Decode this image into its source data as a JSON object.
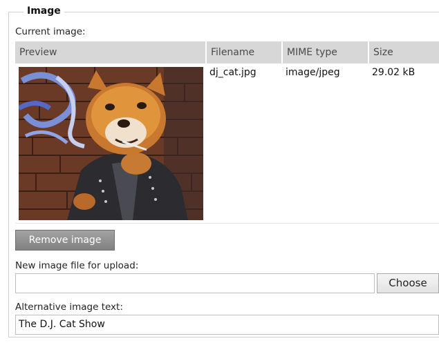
{
  "section": {
    "legend": "Image",
    "current_image_label": "Current image:"
  },
  "table": {
    "headers": [
      "Preview",
      "Filename",
      "MIME type",
      "Size"
    ],
    "row": {
      "filename": "dj_cat.jpg",
      "mime": "image/jpeg",
      "size": "29.02 kB"
    }
  },
  "actions": {
    "remove_label": "Remove image",
    "upload_label": "New image file for upload:",
    "upload_value": "",
    "choose_label": "Choose",
    "alt_label": "Alternative image text:",
    "alt_value": "The D.J. Cat Show"
  }
}
